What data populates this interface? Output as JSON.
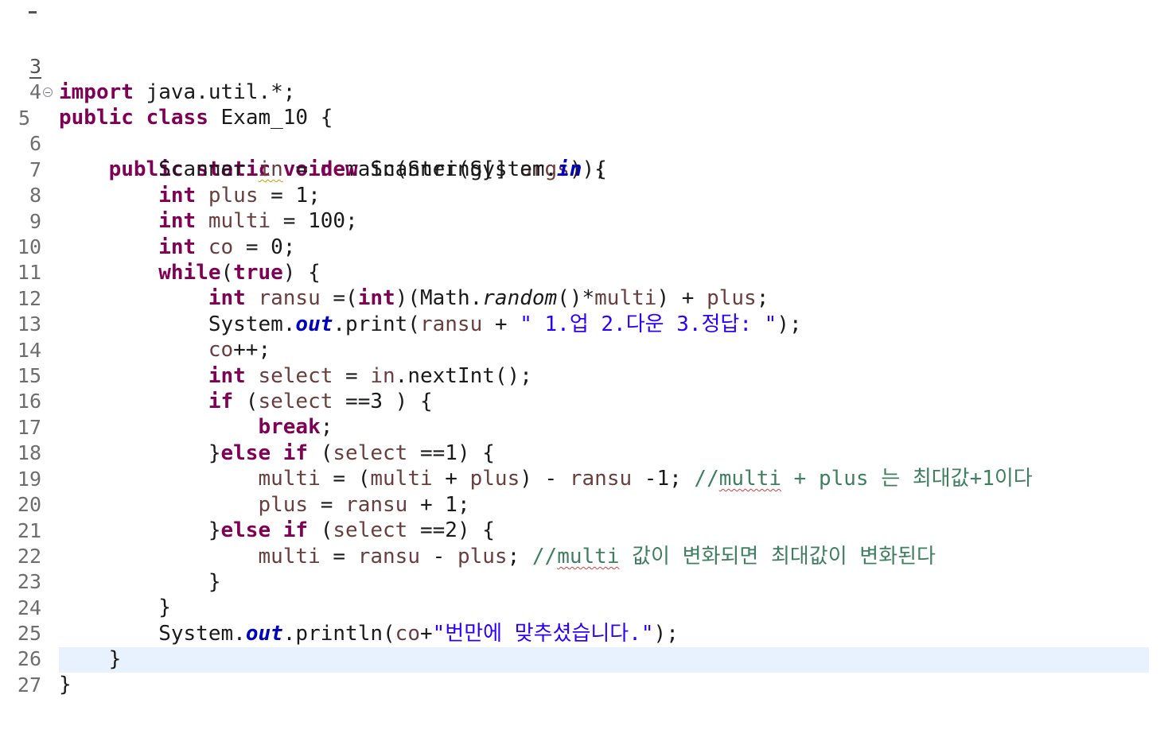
{
  "editor": {
    "lines": [
      {
        "num": "3",
        "text": "import java.util.*;"
      },
      {
        "num": "4",
        "text": "public class Exam_10 {"
      },
      {
        "num": "5",
        "text": "    public static void main(String[] args) {"
      },
      {
        "num": "6",
        "text": "        Scanner in = new Scanner(System.in);"
      },
      {
        "num": "7",
        "text": "        int plus = 1;"
      },
      {
        "num": "8",
        "text": "        int multi = 100;"
      },
      {
        "num": "9",
        "text": "        int co = 0;"
      },
      {
        "num": "10",
        "text": "        while(true) {"
      },
      {
        "num": "11",
        "text": "            int ransu =(int)(Math.random()*multi) + plus;"
      },
      {
        "num": "12",
        "text": "            System.out.print(ransu + \" 1.업 2.다운 3.정답: \");"
      },
      {
        "num": "13",
        "text": "            co++;"
      },
      {
        "num": "14",
        "text": "            int select = in.nextInt();"
      },
      {
        "num": "15",
        "text": "            if (select ==3 ) {"
      },
      {
        "num": "16",
        "text": "                break;"
      },
      {
        "num": "17",
        "text": "            }else if (select ==1) {"
      },
      {
        "num": "18",
        "text": "                multi = (multi + plus) - ransu -1; //multi + plus 는 최대값+1이다"
      },
      {
        "num": "19",
        "text": "                plus = ransu + 1;"
      },
      {
        "num": "20",
        "text": "            }else if (select ==2) {"
      },
      {
        "num": "21",
        "text": "                multi = ransu - plus; //multi 값이 변화되면 최대값이 변화된다"
      },
      {
        "num": "22",
        "text": "            }"
      },
      {
        "num": "23",
        "text": "        }"
      },
      {
        "num": "24",
        "text": "        System.out.println(co+\"번만에 맞추셨습니다.\");"
      },
      {
        "num": "25",
        "text": "    }"
      },
      {
        "num": "26",
        "text": "}"
      },
      {
        "num": "27",
        "text": ""
      }
    ]
  },
  "colors": {
    "keyword": "#7f0055",
    "string": "#2a00ff",
    "comment": "#3f7f5f",
    "local_variable": "#6a3e3e",
    "static_field": "#0000c0",
    "current_line_highlight": "#e8f2fe"
  },
  "icons": {
    "fold": "collapse-minus-icon"
  }
}
